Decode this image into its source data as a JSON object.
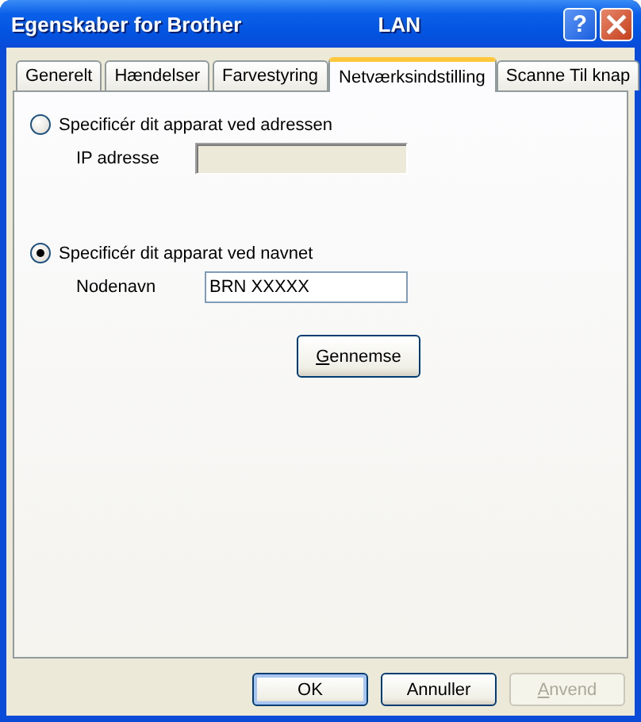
{
  "window": {
    "title": "Egenskaber for Brother",
    "subtitle": "LAN",
    "help_glyph": "?"
  },
  "tabs": [
    {
      "label": "Generelt",
      "selected": false
    },
    {
      "label": "Hændelser",
      "selected": false
    },
    {
      "label": "Farvestyring",
      "selected": false
    },
    {
      "label": "Netværksindstilling",
      "selected": true
    },
    {
      "label": "Scanne Til knap",
      "selected": false
    }
  ],
  "options": [
    {
      "label": "Specificér dit apparat ved adressen",
      "selected": false,
      "field": {
        "label": "IP adresse",
        "disabled": true
      }
    },
    {
      "label": "Specificér dit apparat ved navnet",
      "selected": true,
      "field": {
        "label": "Nodenavn",
        "value": "BRN XXXXX",
        "disabled": false
      }
    }
  ],
  "browse_button": "Gennemse",
  "buttons": [
    {
      "label": "OK",
      "default": true,
      "disabled": false
    },
    {
      "label": "Annuller",
      "default": false,
      "disabled": false
    },
    {
      "label": "Anvend",
      "default": false,
      "disabled": true
    }
  ]
}
